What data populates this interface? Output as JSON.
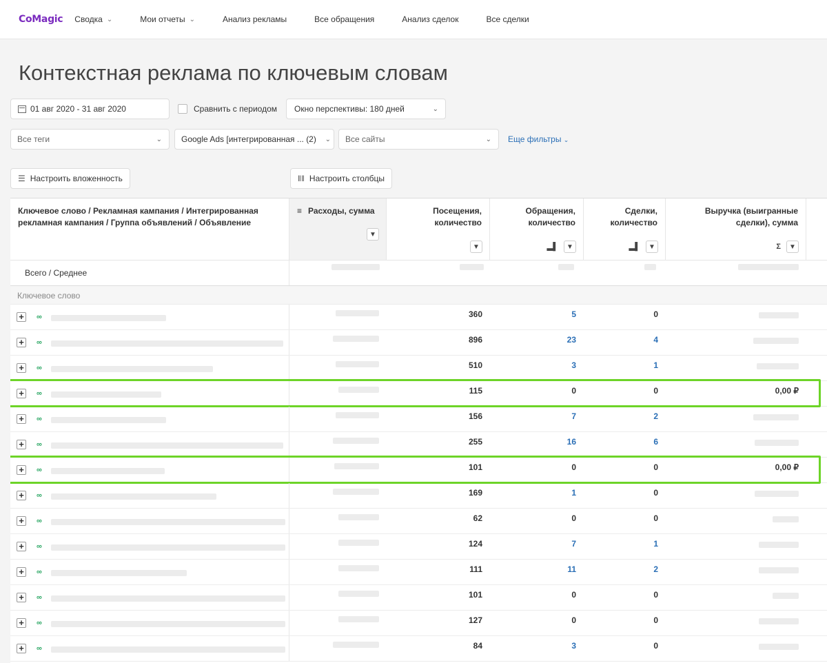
{
  "logo": {
    "text": "CoMagic"
  },
  "nav": [
    {
      "label": "Сводка",
      "dropdown": true
    },
    {
      "label": "Мои отчеты",
      "dropdown": true
    },
    {
      "label": "Анализ рекламы",
      "dropdown": false
    },
    {
      "label": "Все обращения",
      "dropdown": false
    },
    {
      "label": "Анализ сделок",
      "dropdown": false
    },
    {
      "label": "Все сделки",
      "dropdown": false
    }
  ],
  "page_title": "Контекстная реклама по ключевым словам",
  "filters": {
    "date_range": "01 авг 2020 - 31 авг 2020",
    "compare_label": "Сравнить с периодом",
    "perspective": "Окно перспективы: 180 дней",
    "tags": "Все теги",
    "ads": "Google Ads [интегрированная ... (2)",
    "sites": "Все сайты",
    "more_filters": "Еще фильтры"
  },
  "buttons": {
    "nesting": "Настроить вложенность",
    "columns": "Настроить столбцы"
  },
  "table": {
    "headers": {
      "keyword": "Ключевое слово / Рекламная кампания / Интегрированная рекламная кампания / Группа объявлений / Объявление",
      "cost": "Расходы, сумма",
      "visits": "Посещения, количество",
      "requests": "Обращения, количество",
      "deals": "Сделки, количество",
      "revenue": "Выручка (выигранные сделки), сумма"
    },
    "total_label": "Всего / Среднее",
    "group_label": "Ключевое слово",
    "rows": [
      {
        "visits": "360",
        "requests": "5",
        "deals": "0",
        "revenue": "",
        "highlight": false
      },
      {
        "visits": "896",
        "requests": "23",
        "deals": "4",
        "revenue": "",
        "highlight": false
      },
      {
        "visits": "510",
        "requests": "3",
        "deals": "1",
        "revenue": "",
        "highlight": false
      },
      {
        "visits": "115",
        "requests": "0",
        "deals": "0",
        "revenue": "0,00 ₽",
        "highlight": true
      },
      {
        "visits": "156",
        "requests": "7",
        "deals": "2",
        "revenue": "",
        "highlight": false
      },
      {
        "visits": "255",
        "requests": "16",
        "deals": "6",
        "revenue": "",
        "highlight": false
      },
      {
        "visits": "101",
        "requests": "0",
        "deals": "0",
        "revenue": "0,00 ₽",
        "highlight": true
      },
      {
        "visits": "169",
        "requests": "1",
        "deals": "0",
        "revenue": "",
        "highlight": false
      },
      {
        "visits": "62",
        "requests": "0",
        "deals": "0",
        "revenue": "",
        "highlight": false
      },
      {
        "visits": "124",
        "requests": "7",
        "deals": "1",
        "revenue": "",
        "highlight": false
      },
      {
        "visits": "111",
        "requests": "11",
        "deals": "2",
        "revenue": "",
        "highlight": false
      },
      {
        "visits": "101",
        "requests": "0",
        "deals": "0",
        "revenue": "",
        "highlight": false
      },
      {
        "visits": "127",
        "requests": "0",
        "deals": "0",
        "revenue": "",
        "highlight": false
      },
      {
        "visits": "84",
        "requests": "3",
        "deals": "0",
        "revenue": "",
        "highlight": false
      }
    ]
  },
  "colors": {
    "link": "#2b6fb6",
    "highlight": "#6dd428",
    "brand": "#7b2cbf",
    "link_icon": "#27a560"
  }
}
